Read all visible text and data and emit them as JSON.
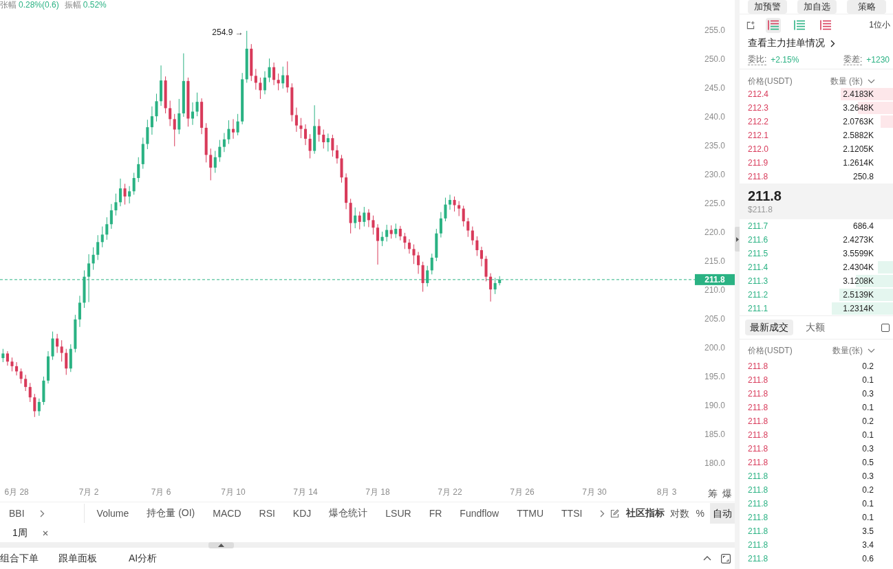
{
  "chart": {
    "stats": [
      {
        "label": "张幅",
        "value": "0.28%(0.6)"
      },
      {
        "label": "振幅",
        "value": "0.52%"
      }
    ],
    "chart_data": [
      {
        "type": "candlestick",
        "x": [
          "--06-27T06:00",
          "--06-27T12:00",
          "--06-27T18:00",
          "--06-28T00:00",
          "--06-28T06:00",
          "--06-28T12:00",
          "--06-28T18:00",
          "--06-29T00:00",
          "--06-29T06:00",
          "--06-29T12:00",
          "--06-29T18:00",
          "--06-30T00:00",
          "--06-30T06:00",
          "--06-30T12:00",
          "--06-30T18:00",
          "--07-01T00:00",
          "--07-01T06:00",
          "--07-01T12:00",
          "--07-01T18:00",
          "--07-02T00:00",
          "--07-02T06:00",
          "--07-02T12:00",
          "--07-02T18:00",
          "--07-03T00:00",
          "--07-03T06:00",
          "--07-03T12:00",
          "--07-03T18:00",
          "--07-04T00:00",
          "--07-04T06:00",
          "--07-04T12:00",
          "--07-04T18:00",
          "--07-05T00:00",
          "--07-05T06:00",
          "--07-05T12:00",
          "--07-05T18:00",
          "--07-06T00:00",
          "--07-06T06:00",
          "--07-06T12:00",
          "--07-06T18:00",
          "--07-07T00:00",
          "--07-07T06:00",
          "--07-07T12:00",
          "--07-07T18:00",
          "--07-08T00:00",
          "--07-08T06:00",
          "--07-08T12:00",
          "--07-08T18:00",
          "--07-09T00:00",
          "--07-09T06:00",
          "--07-09T12:00",
          "--07-09T18:00",
          "--07-10T00:00",
          "--07-10T06:00",
          "--07-10T12:00",
          "--07-10T18:00",
          "--07-11T00:00",
          "--07-11T06:00",
          "--07-11T12:00",
          "--07-11T18:00",
          "--07-12T00:00",
          "--07-12T06:00",
          "--07-12T12:00",
          "--07-12T18:00",
          "--07-13T00:00",
          "--07-13T06:00",
          "--07-13T12:00",
          "--07-13T18:00",
          "--07-14T00:00",
          "--07-14T06:00",
          "--07-14T12:00",
          "--07-14T18:00",
          "--07-15T00:00",
          "--07-15T06:00",
          "--07-15T12:00",
          "--07-15T18:00",
          "--07-16T00:00",
          "--07-16T06:00",
          "--07-16T12:00",
          "--07-16T18:00",
          "--07-17T00:00",
          "--07-17T06:00",
          "--07-17T12:00",
          "--07-17T18:00",
          "--07-18T00:00",
          "--07-18T06:00",
          "--07-18T12:00",
          "--07-18T18:00",
          "--07-19T00:00",
          "--07-19T06:00",
          "--07-19T12:00",
          "--07-19T18:00",
          "--07-20T00:00",
          "--07-20T06:00",
          "--07-20T12:00",
          "--07-20T18:00",
          "--07-21T00:00",
          "--07-21T06:00",
          "--07-21T12:00",
          "--07-21T18:00",
          "--07-22T00:00",
          "--07-22T06:00",
          "--07-22T12:00",
          "--07-22T18:00",
          "--07-23T00:00",
          "--07-23T06:00",
          "--07-23T12:00",
          "--07-23T18:00",
          "--07-24T00:00",
          "--07-24T06:00",
          "--07-24T12:00",
          "--07-24T18:00"
        ],
        "ohlc": [
          [
            198.2,
            199.8,
            197.5,
            199.0
          ],
          [
            199.0,
            199.4,
            196.9,
            197.6
          ],
          [
            197.6,
            198.3,
            195.9,
            196.8
          ],
          [
            196.8,
            197.5,
            195.2,
            195.9
          ],
          [
            195.9,
            196.4,
            193.8,
            194.6
          ],
          [
            194.6,
            195.3,
            192.5,
            193.2
          ],
          [
            193.2,
            193.9,
            190.6,
            191.4
          ],
          [
            191.4,
            192.0,
            188.0,
            189.0
          ],
          [
            189.0,
            191.2,
            188.2,
            190.6
          ],
          [
            190.6,
            195.0,
            190.1,
            194.3
          ],
          [
            194.3,
            199.4,
            193.8,
            198.5
          ],
          [
            198.5,
            202.8,
            197.9,
            201.6
          ],
          [
            201.6,
            202.4,
            199.1,
            200.2
          ],
          [
            200.2,
            201.3,
            197.6,
            199.1
          ],
          [
            199.1,
            199.8,
            195.3,
            196.4
          ],
          [
            196.4,
            200.6,
            195.8,
            199.8
          ],
          [
            199.8,
            205.7,
            199.2,
            204.9
          ],
          [
            204.9,
            209.0,
            203.6,
            207.8
          ],
          [
            207.8,
            213.4,
            206.9,
            212.3
          ],
          [
            212.3,
            216.2,
            207.9,
            214.6
          ],
          [
            214.6,
            217.4,
            213.5,
            216.1
          ],
          [
            216.1,
            219.5,
            215.2,
            218.3
          ],
          [
            218.3,
            221.0,
            217.4,
            219.6
          ],
          [
            219.6,
            222.6,
            218.7,
            221.4
          ],
          [
            221.4,
            224.9,
            220.6,
            223.8
          ],
          [
            223.8,
            226.7,
            222.9,
            225.2
          ],
          [
            225.2,
            229.3,
            224.5,
            227.6
          ],
          [
            227.6,
            228.4,
            224.8,
            226.2
          ],
          [
            226.2,
            228.0,
            225.0,
            227.1
          ],
          [
            227.1,
            230.3,
            226.5,
            229.4
          ],
          [
            229.4,
            233.0,
            228.7,
            231.8
          ],
          [
            231.8,
            236.4,
            231.0,
            235.3
          ],
          [
            235.3,
            239.5,
            234.4,
            238.2
          ],
          [
            238.2,
            241.8,
            236.9,
            240.1
          ],
          [
            240.1,
            244.0,
            239.2,
            242.7
          ],
          [
            242.7,
            248.9,
            241.9,
            246.3
          ],
          [
            246.3,
            247.0,
            240.6,
            241.5
          ],
          [
            241.5,
            242.8,
            238.4,
            239.6
          ],
          [
            239.6,
            240.5,
            234.9,
            237.8
          ],
          [
            237.8,
            243.1,
            237.0,
            240.6
          ],
          [
            240.6,
            251.0,
            240.0,
            246.2
          ],
          [
            246.2,
            246.8,
            238.3,
            239.7
          ],
          [
            239.7,
            242.5,
            238.6,
            240.9
          ],
          [
            240.9,
            244.2,
            240.1,
            242.6
          ],
          [
            242.6,
            243.2,
            237.0,
            238.1
          ],
          [
            238.1,
            238.9,
            232.1,
            233.4
          ],
          [
            233.4,
            234.5,
            229.0,
            231.2
          ],
          [
            231.2,
            234.1,
            230.3,
            233.0
          ],
          [
            233.0,
            236.0,
            232.2,
            234.8
          ],
          [
            234.8,
            237.2,
            233.9,
            236.1
          ],
          [
            236.1,
            239.4,
            235.3,
            237.9
          ],
          [
            237.9,
            239.6,
            236.2,
            237.3
          ],
          [
            237.3,
            240.5,
            236.8,
            239.2
          ],
          [
            239.2,
            247.6,
            238.7,
            246.5
          ],
          [
            246.5,
            254.9,
            245.9,
            251.8
          ],
          [
            251.8,
            252.6,
            246.2,
            247.1
          ],
          [
            247.1,
            248.3,
            244.7,
            245.9
          ],
          [
            245.9,
            246.8,
            243.1,
            244.6
          ],
          [
            244.6,
            247.9,
            243.9,
            246.8
          ],
          [
            246.8,
            250.1,
            246.0,
            248.6
          ],
          [
            248.6,
            249.4,
            245.5,
            246.4
          ],
          [
            246.4,
            247.5,
            244.6,
            245.8
          ],
          [
            245.8,
            248.7,
            244.9,
            247.2
          ],
          [
            247.2,
            249.6,
            244.2,
            245.1
          ],
          [
            245.1,
            245.8,
            239.2,
            240.3
          ],
          [
            240.3,
            241.6,
            237.4,
            238.5
          ],
          [
            238.5,
            239.8,
            236.3,
            237.9
          ],
          [
            237.9,
            238.7,
            235.1,
            236.2
          ],
          [
            236.2,
            237.0,
            232.8,
            234.1
          ],
          [
            234.1,
            242.0,
            233.6,
            238.4
          ],
          [
            238.4,
            239.6,
            235.7,
            236.9
          ],
          [
            236.9,
            237.8,
            234.5,
            235.6
          ],
          [
            235.6,
            237.1,
            234.0,
            236.3
          ],
          [
            236.3,
            236.9,
            233.1,
            234.2
          ],
          [
            234.2,
            235.1,
            231.9,
            232.8
          ],
          [
            232.8,
            233.4,
            228.6,
            229.5
          ],
          [
            229.5,
            230.2,
            224.0,
            225.1
          ],
          [
            225.1,
            225.8,
            219.8,
            221.6
          ],
          [
            221.6,
            224.3,
            220.7,
            222.9
          ],
          [
            222.9,
            223.6,
            220.5,
            221.8
          ],
          [
            221.8,
            224.4,
            221.0,
            223.4
          ],
          [
            223.4,
            224.0,
            220.9,
            222.1
          ],
          [
            222.1,
            222.9,
            219.6,
            220.8
          ],
          [
            220.8,
            221.4,
            214.4,
            218.5
          ],
          [
            218.5,
            220.1,
            217.6,
            219.2
          ],
          [
            219.2,
            221.3,
            218.4,
            220.4
          ],
          [
            220.4,
            221.2,
            218.9,
            219.7
          ],
          [
            219.7,
            221.5,
            219.0,
            220.6
          ],
          [
            220.6,
            221.1,
            218.6,
            219.3
          ],
          [
            219.3,
            219.9,
            217.1,
            218.2
          ],
          [
            218.2,
            218.8,
            216.3,
            217.1
          ],
          [
            217.1,
            217.9,
            214.5,
            216.0
          ],
          [
            216.0,
            216.6,
            212.8,
            214.3
          ],
          [
            214.3,
            214.9,
            209.7,
            211.2
          ],
          [
            211.2,
            214.2,
            210.6,
            213.4
          ],
          [
            213.4,
            216.3,
            212.7,
            215.6
          ],
          [
            215.6,
            220.6,
            215.0,
            219.8
          ],
          [
            219.8,
            223.5,
            219.1,
            222.4
          ],
          [
            222.4,
            226.0,
            221.9,
            224.8
          ],
          [
            224.8,
            226.5,
            223.9,
            225.6
          ],
          [
            225.6,
            226.2,
            223.6,
            224.7
          ],
          [
            224.7,
            225.4,
            222.8,
            224.1
          ],
          [
            224.1,
            224.6,
            221.0,
            221.9
          ],
          [
            221.9,
            222.5,
            219.2,
            220.3
          ],
          [
            220.3,
            221.0,
            217.8,
            218.6
          ],
          [
            218.6,
            219.3,
            215.9,
            216.9
          ],
          [
            216.9,
            217.5,
            214.1,
            215.4
          ],
          [
            215.4,
            215.9,
            211.5,
            212.3
          ],
          [
            212.3,
            212.9,
            208.0,
            210.1
          ],
          [
            210.1,
            212.1,
            209.3,
            211.2
          ],
          [
            211.2,
            212.4,
            210.8,
            211.8
          ]
        ],
        "xlim": [
          "--06-27T02:00",
          "--08-04T13:30"
        ],
        "ylim": [
          180,
          255
        ],
        "xticks": [
          {
            "value": "--06-28",
            "label": "6月 28"
          },
          {
            "value": "--07-02",
            "label": "7月 2"
          },
          {
            "value": "--07-06",
            "label": "7月 6"
          },
          {
            "value": "--07-10",
            "label": "7月 10"
          },
          {
            "value": "--07-14",
            "label": "7月 14"
          },
          {
            "value": "--07-18",
            "label": "7月 18"
          },
          {
            "value": "--07-22",
            "label": "7月 22"
          },
          {
            "value": "--07-26",
            "label": "7月 26"
          },
          {
            "value": "--07-30",
            "label": "7月 30"
          },
          {
            "value": "--08-03",
            "label": "8月 3"
          }
        ],
        "yticks": [
          {
            "value": 180,
            "label": "180.0"
          },
          {
            "value": 185,
            "label": "185.0"
          },
          {
            "value": 190,
            "label": "190.0"
          },
          {
            "value": 195,
            "label": "195.0"
          },
          {
            "value": 200,
            "label": "200.0"
          },
          {
            "value": 205,
            "label": "205.0"
          },
          {
            "value": 210,
            "label": "210.0"
          },
          {
            "value": 215,
            "label": "215.0"
          },
          {
            "value": 220,
            "label": "220.0"
          },
          {
            "value": 225,
            "label": "225.0"
          },
          {
            "value": 230,
            "label": "230.0"
          },
          {
            "value": 235,
            "label": "235.0"
          },
          {
            "value": 240,
            "label": "240.0"
          },
          {
            "value": 245,
            "label": "245.0"
          },
          {
            "value": 250,
            "label": "250.0"
          },
          {
            "value": 255,
            "label": "255.0"
          }
        ],
        "ref_lines": [
          {
            "axis": "y",
            "value": 211.8,
            "label": "211.8",
            "color": "#2ab283",
            "line_style": "dashed"
          }
        ],
        "annotations": [
          "254.9 →"
        ]
      }
    ],
    "side_buttons": [
      "筹",
      "爆"
    ]
  },
  "indicator_bar": {
    "pinned": "BBI",
    "indicators": [
      "Volume",
      "持仓量 (OI)",
      "MACD",
      "RSI",
      "KDJ",
      "爆仓统计",
      "LSUR",
      "FR",
      "Fundflow",
      "TTMU",
      "TTSI"
    ],
    "community": "社区指标",
    "scale_modes": [
      {
        "label": "对数",
        "selected": false
      },
      {
        "label": "%",
        "selected": false
      },
      {
        "label": "自动",
        "selected": true
      }
    ]
  },
  "timeframe_chip": "1周",
  "bottom_tabs": [
    "组合下单",
    "跟单面板",
    "AI分析"
  ],
  "order_panel": {
    "actions": [
      "加预警",
      "加自选",
      "策略"
    ],
    "view_modes": [
      {
        "kind": "both",
        "selected": true
      },
      {
        "kind": "bids",
        "selected": false
      },
      {
        "kind": "asks",
        "selected": false
      }
    ],
    "precision": "1位小",
    "main_orders_link": "查看主力挂单情况",
    "ratio": {
      "label": "委比:",
      "value": "+2.15%"
    },
    "difference": {
      "label": "委差:",
      "value": "+1230"
    },
    "columns": [
      "价格(USDT)",
      "数量 (张)"
    ],
    "asks": [
      {
        "price": "212.4",
        "quantity": "2.4183K",
        "level": 0.34
      },
      {
        "price": "212.3",
        "quantity": "3.2648K",
        "level": 0.23
      },
      {
        "price": "212.2",
        "quantity": "2.0763K",
        "level": 0.08
      },
      {
        "price": "212.1",
        "quantity": "2.5882K"
      },
      {
        "price": "212.0",
        "quantity": "2.1205K"
      },
      {
        "price": "211.9",
        "quantity": "1.2614K"
      },
      {
        "price": "211.8",
        "quantity": "250.8"
      }
    ],
    "mid": {
      "price": "211.8",
      "usd": "$211.8"
    },
    "bids": [
      {
        "price": "211.7",
        "quantity": "686.4"
      },
      {
        "price": "211.6",
        "quantity": "2.4273K"
      },
      {
        "price": "211.5",
        "quantity": "3.5599K"
      },
      {
        "price": "211.4",
        "quantity": "2.4304K",
        "level": 0.1
      },
      {
        "price": "211.3",
        "quantity": "3.1208K",
        "level": 0.24
      },
      {
        "price": "211.2",
        "quantity": "2.5139K",
        "level": 0.35
      },
      {
        "price": "211.1",
        "quantity": "1.2314K",
        "level": 0.4
      }
    ]
  },
  "trades": {
    "tabs": [
      {
        "label": "最新成交",
        "selected": true
      },
      {
        "label": "大额",
        "selected": false
      }
    ],
    "checkbox": {
      "checked": false
    },
    "columns": [
      "价格(USDT)",
      "数量(张)"
    ],
    "rows": [
      {
        "price": "211.8",
        "quantity": "0.2",
        "color": "#d83a5a"
      },
      {
        "price": "211.8",
        "quantity": "0.1",
        "color": "#d83a5a"
      },
      {
        "price": "211.8",
        "quantity": "0.3",
        "color": "#d83a5a"
      },
      {
        "price": "211.8",
        "quantity": "0.1",
        "color": "#d83a5a"
      },
      {
        "price": "211.8",
        "quantity": "0.2",
        "color": "#d83a5a"
      },
      {
        "price": "211.8",
        "quantity": "0.1",
        "color": "#d83a5a"
      },
      {
        "price": "211.8",
        "quantity": "0.3",
        "color": "#d83a5a"
      },
      {
        "price": "211.8",
        "quantity": "0.5",
        "color": "#d83a5a"
      },
      {
        "price": "211.8",
        "quantity": "0.3",
        "color": "#2ab283"
      },
      {
        "price": "211.8",
        "quantity": "0.2",
        "color": "#2ab283"
      },
      {
        "price": "211.8",
        "quantity": "0.1",
        "color": "#2ab283"
      },
      {
        "price": "211.8",
        "quantity": "0.1",
        "color": "#2ab283"
      },
      {
        "price": "211.8",
        "quantity": "3.5",
        "color": "#2ab283"
      },
      {
        "price": "211.8",
        "quantity": "3.4",
        "color": "#2ab283"
      },
      {
        "price": "211.8",
        "quantity": "0.6",
        "color": "#2ab283"
      }
    ]
  }
}
